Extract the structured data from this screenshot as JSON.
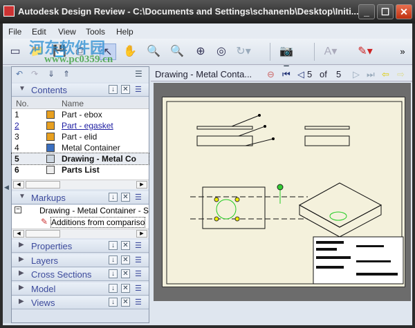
{
  "window": {
    "title": "Autodesk Design Review - C:\\Documents and Settings\\schanenb\\Desktop\\Initi..."
  },
  "watermark": {
    "name": "河东软件园",
    "url": "www.pc0359.cn"
  },
  "menu": [
    "File",
    "Edit",
    "View",
    "Tools",
    "Help"
  ],
  "toolbar": [
    "new-icon",
    "open-icon",
    "save-icon",
    "print-icon",
    "select-icon",
    "pan-icon",
    "zoom-icon",
    "zoom-window-icon",
    "fit-icon",
    "orbit-icon",
    "rotate-icon",
    "camera-icon",
    "text-icon",
    "markup-icon"
  ],
  "panels": {
    "contents": {
      "title": "Contents",
      "col_no": "No.",
      "col_name": "Name",
      "items": [
        {
          "no": "1",
          "name": "Part - ebox",
          "icon": "part-icon"
        },
        {
          "no": "2",
          "name": "Part - egasket",
          "icon": "part-icon",
          "link": true
        },
        {
          "no": "3",
          "name": "Part - elid",
          "icon": "part-icon"
        },
        {
          "no": "4",
          "name": "Metal Container",
          "icon": "assembly-icon"
        },
        {
          "no": "5",
          "name": "Drawing - Metal Co",
          "icon": "drawing-icon",
          "bold": true
        },
        {
          "no": "6",
          "name": "Parts List",
          "icon": "table-icon",
          "bold": true
        }
      ]
    },
    "markups": {
      "title": "Markups",
      "tree": [
        "Drawing - Metal Container - S",
        "Additions from compariso"
      ]
    },
    "collapsed": [
      "Properties",
      "Layers",
      "Cross Sections",
      "Model",
      "Views"
    ]
  },
  "viewer": {
    "sheet_title": "Drawing - Metal Conta...",
    "page": "5",
    "of_label": "of",
    "total": "5"
  }
}
